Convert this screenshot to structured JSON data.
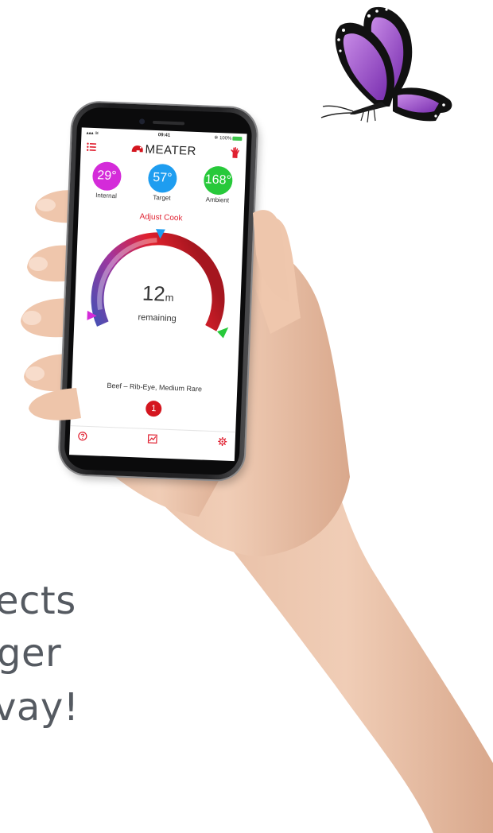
{
  "background": {
    "lines": [
      "ects",
      "ger",
      "vay!"
    ]
  },
  "phone": {
    "statusbar": {
      "signal": "▴▴▴ ≋",
      "time": "09:41",
      "battery_text": "✲ 100%"
    },
    "app": {
      "brand": "MEATER",
      "temperatures": [
        {
          "label": "Internal",
          "value": "29°",
          "color": "#d42bd9"
        },
        {
          "label": "Target",
          "value": "57°",
          "color": "#1e9df0"
        },
        {
          "label": "Ambient",
          "value": "168°",
          "color": "#27c93a"
        }
      ],
      "adjust_cook_label": "Adjust Cook",
      "remaining": {
        "value": "12",
        "unit": "m",
        "label": "remaining"
      },
      "cook_name": "Beef – Rib-Eye, Medium Rare",
      "alert_count": "1",
      "colors": {
        "accent": "#e02030",
        "gauge_start": "#4a4fb3",
        "gauge_end": "#c5202b"
      }
    },
    "nav": {
      "icons": [
        "help-icon",
        "graph-icon",
        "settings-icon"
      ]
    }
  }
}
